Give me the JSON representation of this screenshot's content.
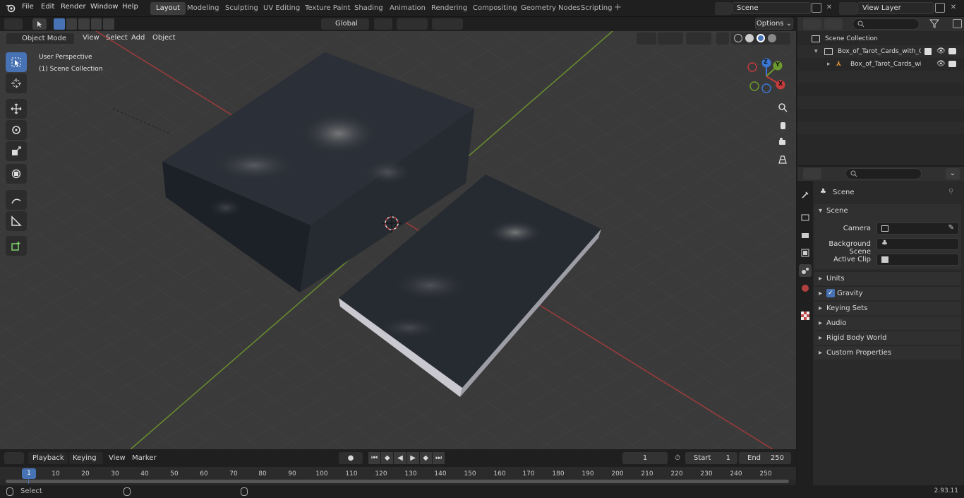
{
  "topbar": {
    "menus": [
      "File",
      "Edit",
      "Render",
      "Window",
      "Help"
    ],
    "workspaces": [
      "Layout",
      "Modeling",
      "Sculpting",
      "UV Editing",
      "Texture Paint",
      "Shading",
      "Animation",
      "Rendering",
      "Compositing",
      "Geometry Nodes",
      "Scripting"
    ],
    "active_workspace": "Layout",
    "scene": "Scene",
    "view_layer": "View Layer"
  },
  "viewport_header": {
    "mode": "Object Mode",
    "view": "View",
    "select": "Select",
    "add": "Add",
    "object": "Object",
    "transform_orientation": "Global",
    "options": "Options"
  },
  "viewport": {
    "perspective": "User Perspective",
    "collection": "(1) Scene Collection",
    "gizmo": {
      "x": "X",
      "y": "Y",
      "z": "Z"
    }
  },
  "outliner": {
    "root": "Scene Collection",
    "items": [
      "Box_of_Tarot_Cards_with_Gui",
      "Box_of_Tarot_Cards_with"
    ]
  },
  "properties": {
    "header": "Scene",
    "panel": "Scene",
    "fields": [
      {
        "label": "Camera"
      },
      {
        "label": "Background Scene"
      },
      {
        "label": "Active Clip"
      }
    ],
    "subpanels": [
      "Units",
      "Gravity",
      "Keying Sets",
      "Audio",
      "Rigid Body World",
      "Custom Properties"
    ]
  },
  "timeline": {
    "playback": "Playback",
    "keying": "Keying",
    "view": "View",
    "marker": "Marker",
    "current_frame": "1",
    "start_label": "Start",
    "start": "1",
    "end_label": "End",
    "end": "250",
    "ticks": [
      "10",
      "20",
      "30",
      "40",
      "50",
      "60",
      "70",
      "80",
      "90",
      "100",
      "110",
      "120",
      "130",
      "140",
      "150",
      "160",
      "170",
      "180",
      "190",
      "200",
      "210",
      "220",
      "230",
      "240",
      "250"
    ],
    "playhead": "1"
  },
  "status": {
    "left": "Select",
    "version": "2.93.11"
  },
  "colors": {
    "accent": "#4772b3",
    "x_axis": "#c43c3c",
    "y_axis": "#6d9a2d",
    "z_axis": "#3b76d4"
  }
}
